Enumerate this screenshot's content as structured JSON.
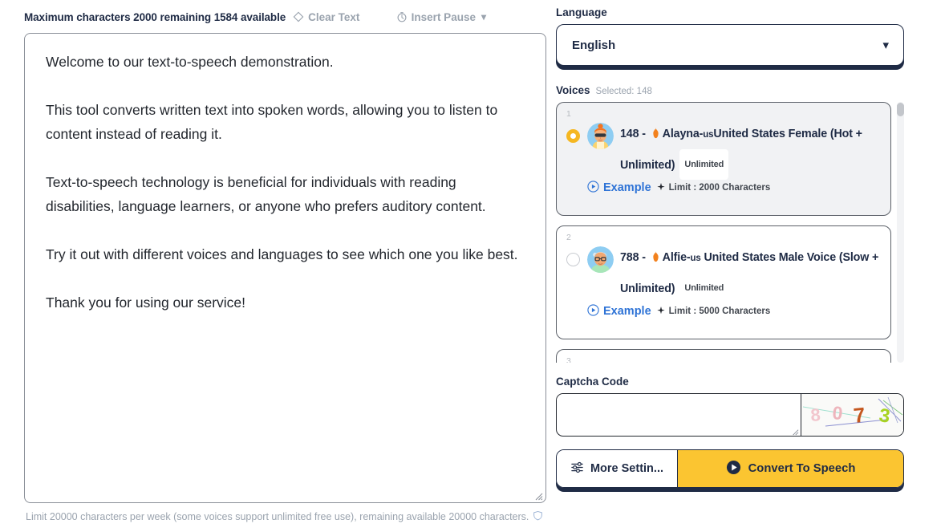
{
  "editor": {
    "counter_text": "Maximum characters 2000 remaining 1584 available",
    "clear_text_label": "Clear Text",
    "clear_text_icon": "eraser-diamond-icon",
    "insert_pause_label": "Insert Pause",
    "insert_pause_icon": "stopwatch-icon",
    "chevron_icon": "chevron-down-icon",
    "textarea_value": "Welcome to our text-to-speech demonstration.\n\nThis tool converts written text into spoken words, allowing you to listen to content instead of reading it.\n\nText-to-speech technology is beneficial for individuals with reading disabilities, language learners, or anyone who prefers auditory content.\n\nTry it out with different voices and languages to see which one you like best.\n\nThank you for using our service!",
    "footer_note": "Limit 20000 characters per week (some voices support unlimited free use), remaining available 20000 characters.",
    "footer_icon": "shield-icon"
  },
  "language": {
    "label": "Language",
    "selected": "English"
  },
  "voices": {
    "title": "Voices",
    "selected_text": "Selected: 148",
    "cards": [
      {
        "index": "1",
        "selected": true,
        "id": "148 - ",
        "name": "Alayna-",
        "name_suffix": "us",
        "desc": "United States Female (Hot + Unlimited)",
        "badge": "Unlimited",
        "example_label": "Example",
        "limit_label": "Limit : 2000 Characters",
        "avatar_icon": "avatar-female-orange-hair",
        "fire_icon": "fire-icon",
        "play_icon": "play-circle-icon",
        "sparkle_icon": "sparkle-icon"
      },
      {
        "index": "2",
        "selected": false,
        "id": "788 - ",
        "name": "Alfie-",
        "name_suffix": "us",
        "desc": " United States Male Voice (Slow + Unlimited)",
        "badge": "Unlimited",
        "example_label": "Example",
        "limit_label": "Limit : 5000 Characters",
        "avatar_icon": "avatar-male-gray-hair-glasses",
        "fire_icon": "fire-icon",
        "play_icon": "play-circle-icon",
        "sparkle_icon": "sparkle-icon"
      },
      {
        "index": "3",
        "selected": false,
        "partial": true
      }
    ]
  },
  "captcha": {
    "label": "Captcha Code",
    "input_value": "",
    "input_placeholder": "",
    "code_characters": [
      "8",
      "0",
      "7",
      "3"
    ]
  },
  "actions": {
    "more_settings_label": "More Settin...",
    "more_settings_icon": "sliders-icon",
    "convert_label": "Convert To Speech",
    "convert_icon": "play-circle-filled-icon"
  },
  "colors": {
    "accent_yellow": "#fbc531",
    "navy": "#1f2b45",
    "link_blue": "#2e73d6",
    "muted_gray": "#9aa3ae",
    "radio_selected": "#f5b721"
  }
}
